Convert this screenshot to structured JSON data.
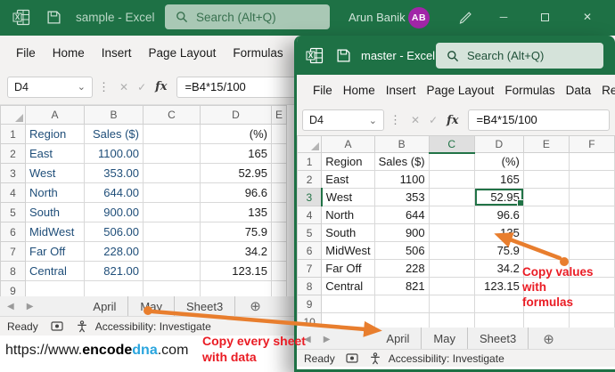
{
  "bg": {
    "title": "sample - Excel",
    "search": "Search (Alt+Q)",
    "user": "Arun Banik",
    "avatar": "AB",
    "menu": [
      "File",
      "Home",
      "Insert",
      "Page Layout",
      "Formulas"
    ],
    "name_box": "D4",
    "formula": "=B4*15/100",
    "cols": [
      "A",
      "B",
      "C",
      "D",
      "E"
    ],
    "rows": [
      {
        "n": "1",
        "a": "Region",
        "b": "Sales ($)",
        "c": "",
        "d": "(%)"
      },
      {
        "n": "2",
        "a": "East",
        "b": "1100.00",
        "c": "",
        "d": "165"
      },
      {
        "n": "3",
        "a": "West",
        "b": "353.00",
        "c": "",
        "d": "52.95"
      },
      {
        "n": "4",
        "a": "North",
        "b": "644.00",
        "c": "",
        "d": "96.6"
      },
      {
        "n": "5",
        "a": "South",
        "b": "900.00",
        "c": "",
        "d": "135"
      },
      {
        "n": "6",
        "a": "MidWest",
        "b": "506.00",
        "c": "",
        "d": "75.9"
      },
      {
        "n": "7",
        "a": "Far Off",
        "b": "228.00",
        "c": "",
        "d": "34.2"
      },
      {
        "n": "8",
        "a": "Central",
        "b": "821.00",
        "c": "",
        "d": "123.15"
      },
      {
        "n": "9",
        "a": "",
        "b": "",
        "c": "",
        "d": ""
      }
    ],
    "tabs": [
      "April",
      "May",
      "Sheet3"
    ],
    "add_sheet": "⊕",
    "status": "Ready",
    "accessibility": "Accessibility: Investigate"
  },
  "fg": {
    "title": "master - Excel",
    "search": "Search (Alt+Q)",
    "menu": [
      "File",
      "Home",
      "Insert",
      "Page Layout",
      "Formulas",
      "Data",
      "Review"
    ],
    "name_box": "D4",
    "formula": "=B4*15/100",
    "selected_cell": "D4",
    "cols": [
      "A",
      "B",
      "C",
      "D",
      "E",
      "F"
    ],
    "rows": [
      {
        "n": "1",
        "a": "Region",
        "b": "Sales ($)",
        "c": "",
        "d": "(%)"
      },
      {
        "n": "2",
        "a": "East",
        "b": "1100",
        "c": "",
        "d": "165"
      },
      {
        "n": "3",
        "a": "West",
        "b": "353",
        "c": "",
        "d": "52.95"
      },
      {
        "n": "4",
        "a": "North",
        "b": "644",
        "c": "",
        "d": "96.6"
      },
      {
        "n": "5",
        "a": "South",
        "b": "900",
        "c": "",
        "d": "135"
      },
      {
        "n": "6",
        "a": "MidWest",
        "b": "506",
        "c": "",
        "d": "75.9"
      },
      {
        "n": "7",
        "a": "Far Off",
        "b": "228",
        "c": "",
        "d": "34.2"
      },
      {
        "n": "8",
        "a": "Central",
        "b": "821",
        "c": "",
        "d": "123.15"
      },
      {
        "n": "9",
        "a": "",
        "b": "",
        "c": "",
        "d": ""
      },
      {
        "n": "10",
        "a": "",
        "b": "",
        "c": "",
        "d": ""
      }
    ],
    "tabs": [
      "April",
      "May",
      "Sheet3"
    ],
    "add_sheet": "⊕",
    "status": "Ready",
    "accessibility": "Accessibility: Investigate"
  },
  "annotations": {
    "copy_values_line1": "Copy values with",
    "copy_values_line2": "formulas",
    "copy_sheets_line1": "Copy every sheet",
    "copy_sheets_line2": "with data"
  },
  "url": {
    "prefix": "https://www.",
    "part_bold": "encode",
    "part_blue": "dna",
    "suffix": ".com"
  },
  "colors": {
    "excel_green": "#1e7145",
    "accent_green": "#217346",
    "arrow_orange": "#e87e2e",
    "annotation_red": "#ea1c24",
    "avatar_purple": "#a126a8",
    "link_blue": "#2aa5de",
    "header_fill_blue": "#dce6f1",
    "header_text_blue": "#1f4e79"
  }
}
